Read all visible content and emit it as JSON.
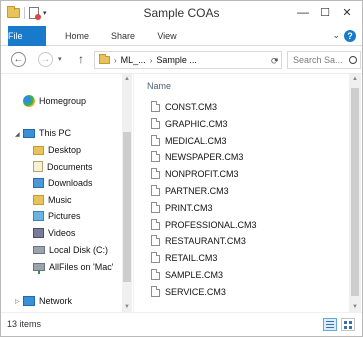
{
  "window": {
    "title": "Sample COAs",
    "controls": {
      "minimize": "—",
      "maximize": "☐",
      "close": "✕"
    }
  },
  "quick_access": {
    "dropdown": "▾"
  },
  "ribbon": {
    "tabs": [
      "File",
      "Home",
      "Share",
      "View"
    ],
    "collapse": "⌄",
    "help": "?"
  },
  "nav": {
    "back": "←",
    "forward": "→",
    "recent": "▾",
    "up": "↑",
    "breadcrumb": [
      "ML_...",
      "Sample ..."
    ],
    "separator": "›",
    "address_dropdown": "▾",
    "refresh": "⟳",
    "search_placeholder": "Search Sa..."
  },
  "sidebar": {
    "homegroup": "Homegroup",
    "thispc": "This PC",
    "items": [
      "Desktop",
      "Documents",
      "Downloads",
      "Music",
      "Pictures",
      "Videos",
      "Local Disk (C:)",
      "AllFiles on 'Mac'"
    ],
    "network": "Network"
  },
  "list": {
    "column_name": "Name",
    "files": [
      "CONST.CM3",
      "GRAPHIC.CM3",
      "MEDICAL.CM3",
      "NEWSPAPER.CM3",
      "NONPROFIT.CM3",
      "PARTNER.CM3",
      "PRINT.CM3",
      "PROFESSIONAL.CM3",
      "RESTAURANT.CM3",
      "RETAIL.CM3",
      "SAMPLE.CM3",
      "SERVICE.CM3"
    ]
  },
  "status": {
    "item_count": "13 items"
  }
}
